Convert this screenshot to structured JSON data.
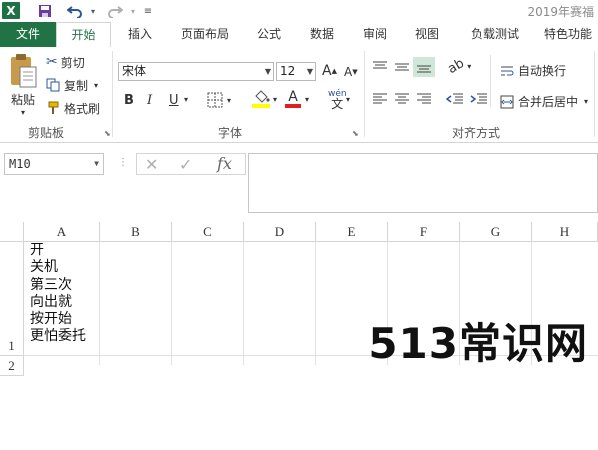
{
  "title_bar": {
    "document_title": "2019年赛福",
    "app_icon_letter": "X"
  },
  "tabs": [
    {
      "label": "文件"
    },
    {
      "label": "开始"
    },
    {
      "label": "插入"
    },
    {
      "label": "页面布局"
    },
    {
      "label": "公式"
    },
    {
      "label": "数据"
    },
    {
      "label": "审阅"
    },
    {
      "label": "视图"
    },
    {
      "label": "负载测试"
    },
    {
      "label": "特色功能"
    }
  ],
  "ribbon": {
    "clipboard": {
      "paste": "粘贴",
      "cut": "剪切",
      "copy": "复制",
      "format_painter": "格式刷",
      "group_label": "剪贴板"
    },
    "font": {
      "font_name": "宋体",
      "font_size": "12",
      "bold": "B",
      "italic": "I",
      "underline": "U",
      "phonetic": "wén",
      "group_label": "字体"
    },
    "alignment": {
      "wrap_text": "自动换行",
      "merge_center": "合并后居中",
      "group_label": "对齐方式"
    }
  },
  "formula_bar": {
    "name_box": "M10",
    "fx": "fx",
    "formula": ""
  },
  "grid": {
    "columns": [
      "A",
      "B",
      "C",
      "D",
      "E",
      "F",
      "G",
      "H"
    ],
    "rows": [
      "1",
      "2"
    ],
    "cell_a1_lines": [
      "开",
      "关机",
      "第三次",
      "向出就",
      "按开始",
      "更怕委托"
    ]
  },
  "watermark": "513常识网",
  "colors": {
    "excel_green": "#217346",
    "highlight_yellow": "#ffff00",
    "font_red": "#e02020"
  }
}
